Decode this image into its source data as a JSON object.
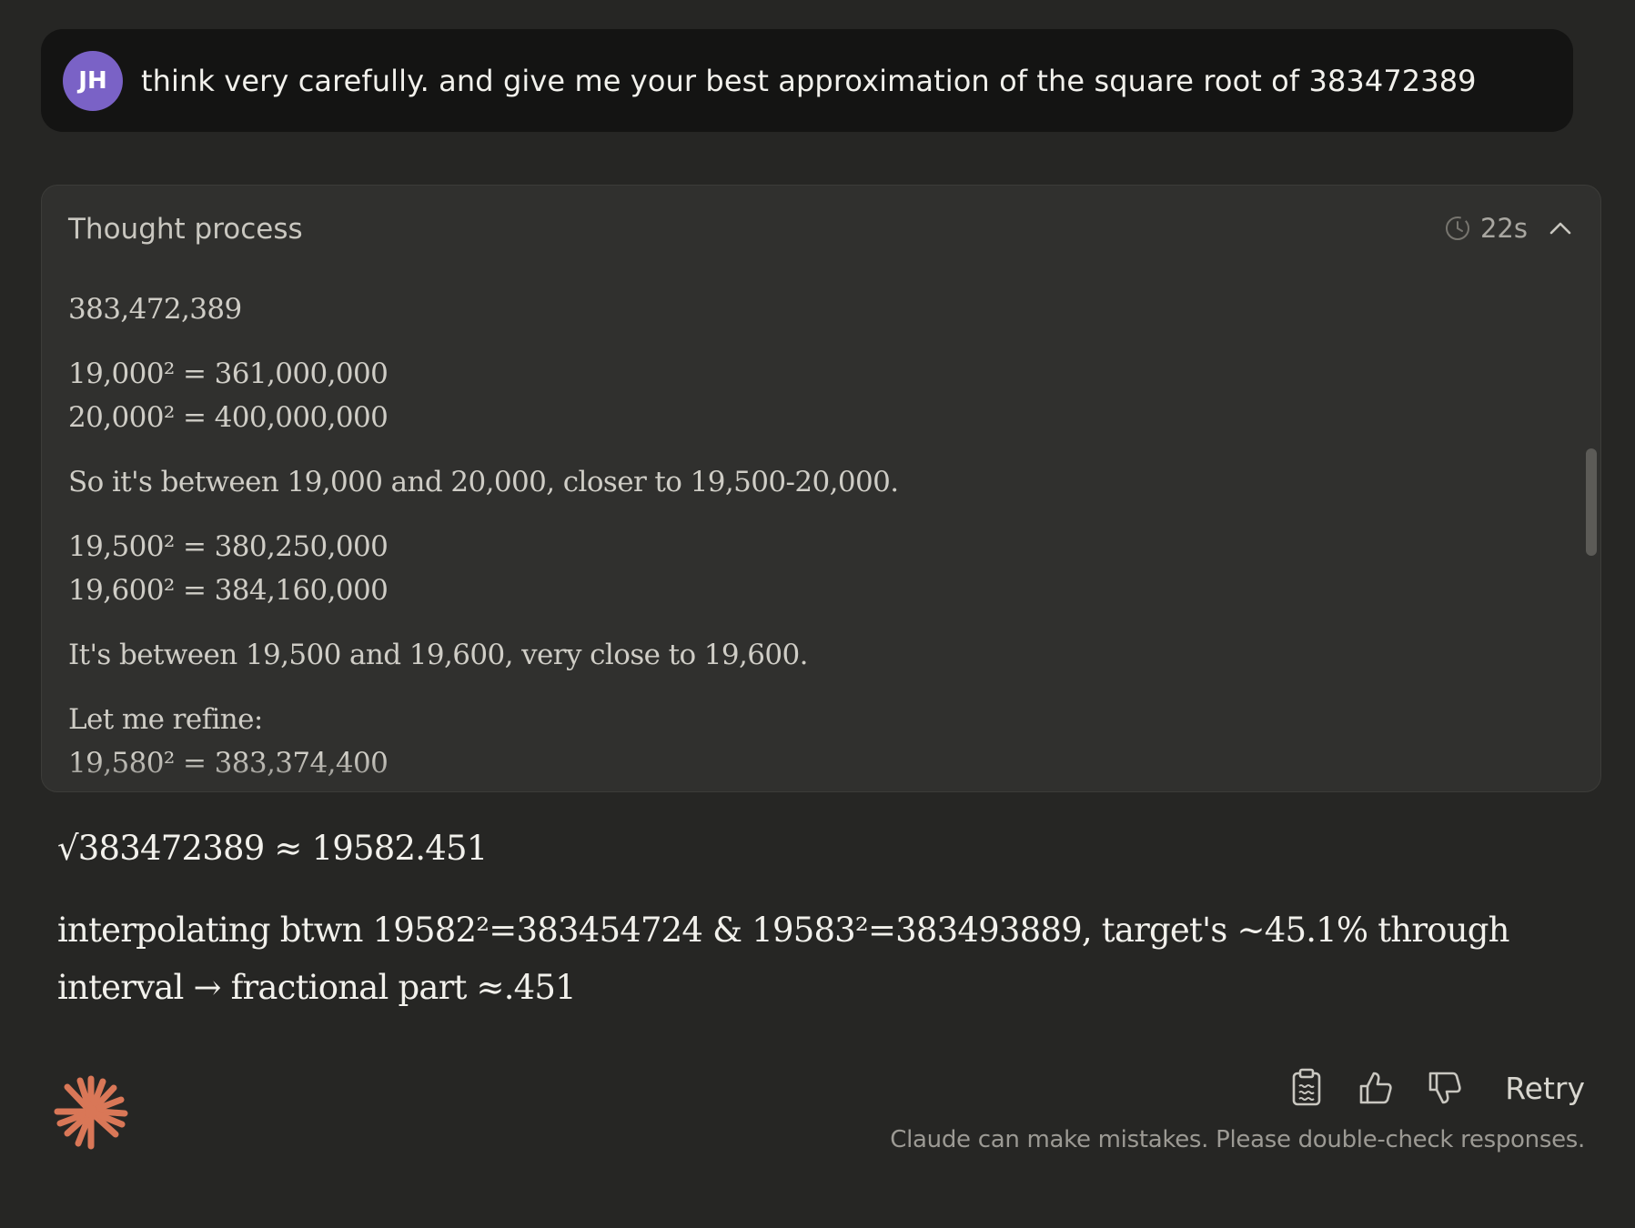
{
  "user_message": {
    "avatar_initials": "JH",
    "text": "think very carefully. and give me your best approximation of the square root of 383472389"
  },
  "thought_process": {
    "title": "Thought process",
    "duration": "22s",
    "lines": [
      "383,472,389",
      "19,000² = 361,000,000",
      "20,000² = 400,000,000",
      "So it's between 19,000 and 20,000, closer to 19,500-20,000.",
      "19,500² = 380,250,000",
      "19,600² = 384,160,000",
      "It's between 19,500 and 19,600, very close to 19,600.",
      "Let me refine:",
      "19,580² = 383,374,400"
    ]
  },
  "answer": {
    "result": "√383472389 ≈ 19582.451",
    "explanation": "interpolating btwn 19582²=383454724 & 19583²=383493889, target's ~45.1% through interval → fractional part ≈.451"
  },
  "footer": {
    "retry_label": "Retry",
    "disclaimer": "Claude can make mistakes. Please double-check responses."
  },
  "colors": {
    "background": "#262624",
    "user_bubble": "#141413",
    "avatar": "#7a62c6",
    "thought_panel": "#30302e",
    "logo_accent": "#d97757"
  },
  "icons": [
    "clock-icon",
    "chevron-up-icon",
    "copy-icon",
    "thumbs-up-icon",
    "thumbs-down-icon",
    "claude-logo-icon"
  ]
}
